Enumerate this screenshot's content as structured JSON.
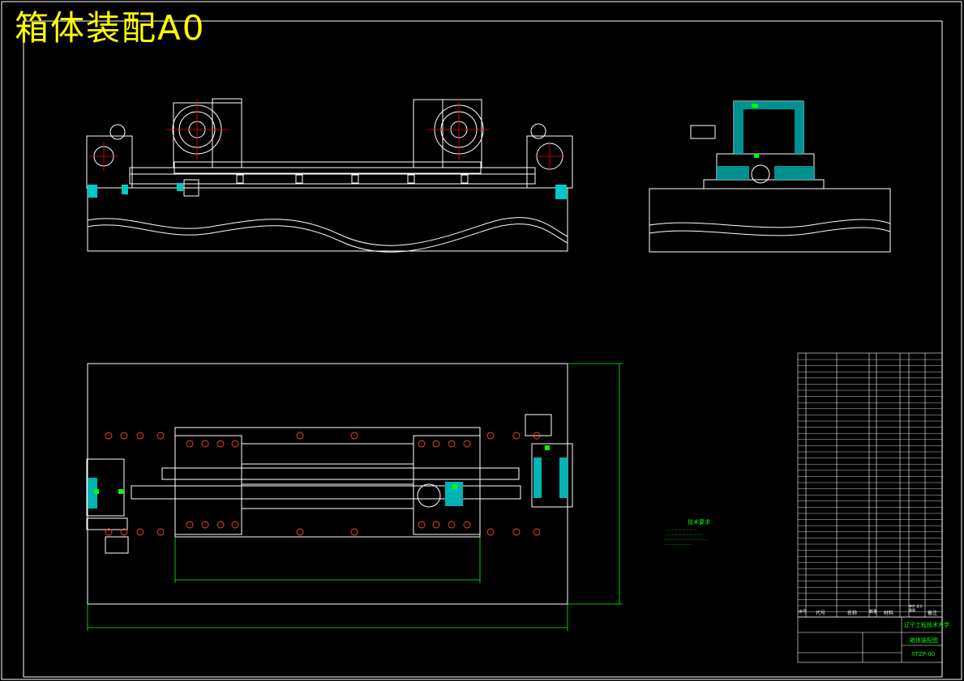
{
  "drawing": {
    "title": "箱体装配A0",
    "colors": {
      "background": "#000000",
      "lines": "#ffffff",
      "title_text": "#ffff00",
      "dimension": "#00ff00",
      "hatch": "#00ffff",
      "center_marks": "#ff0000"
    }
  },
  "technical_requirements": {
    "title": "技术要求"
  },
  "title_block": {
    "header": {
      "no": "序号",
      "code": "代号",
      "name": "名称",
      "qty": "数量",
      "material": "材料",
      "weight": "单件 总计 重量",
      "remark": "备注"
    },
    "school": "辽宁工程技术大学",
    "drawing_name": "箱体装配图",
    "drawing_no": "XTZP-00"
  }
}
